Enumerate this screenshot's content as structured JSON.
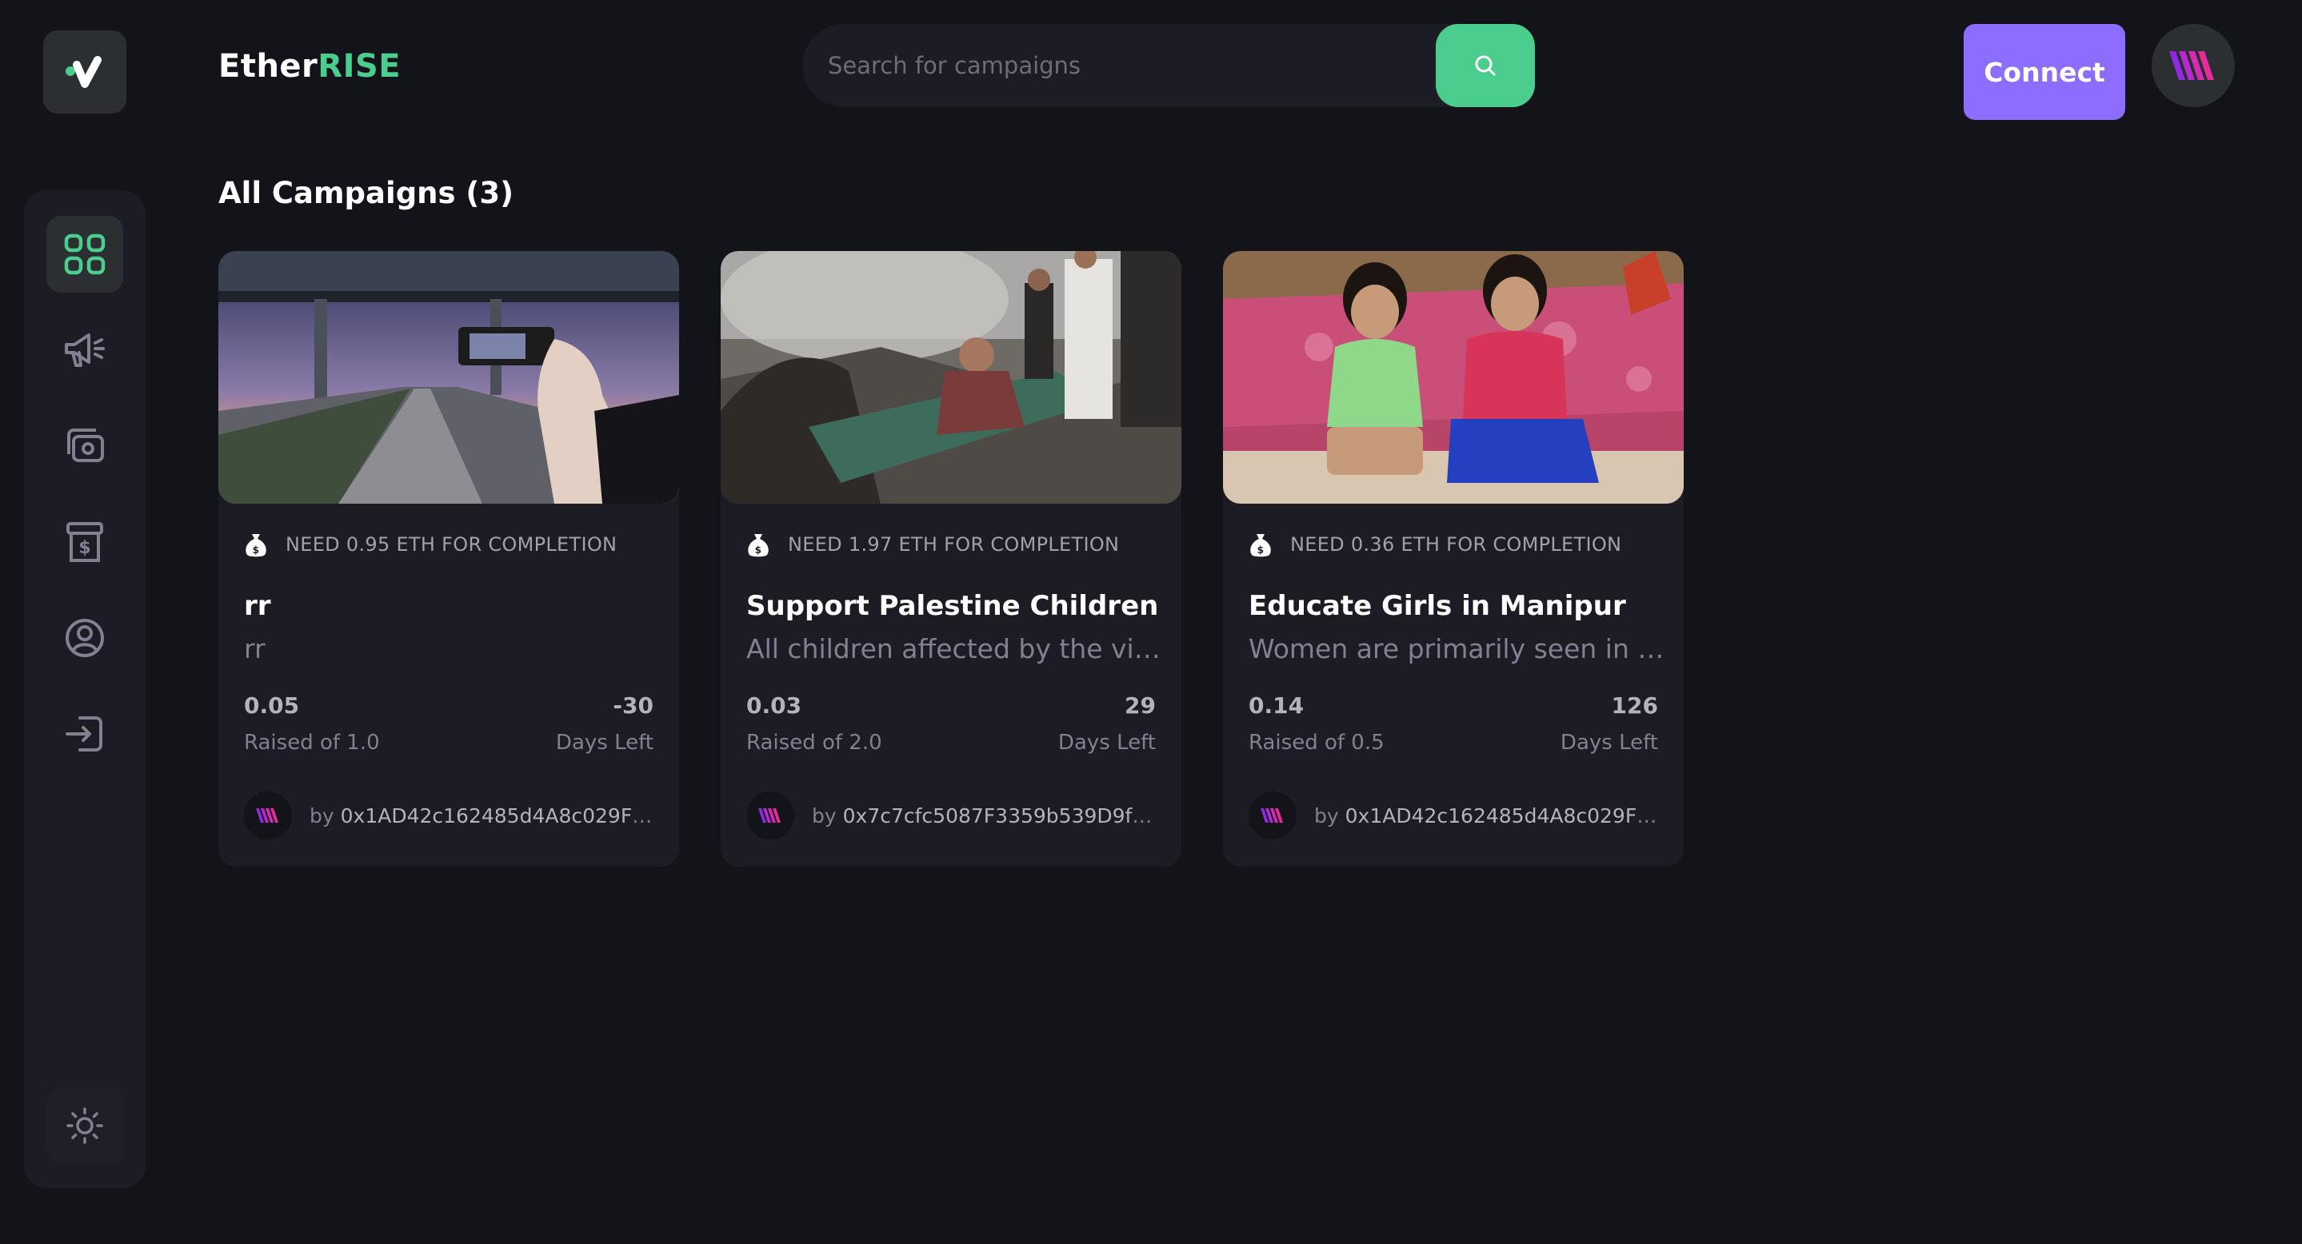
{
  "app": {
    "brand_main": "Ether",
    "brand_accent": "RISE"
  },
  "search": {
    "placeholder": "Search for campaigns"
  },
  "header": {
    "connect_label": "Connect"
  },
  "sidebar": {
    "items": [
      {
        "name": "dashboard",
        "icon": "dashboard-grid-icon",
        "active": true
      },
      {
        "name": "campaign",
        "icon": "megaphone-icon",
        "active": false
      },
      {
        "name": "payment",
        "icon": "payment-icon",
        "active": false
      },
      {
        "name": "withdraw",
        "icon": "withdraw-icon",
        "active": false
      },
      {
        "name": "profile",
        "icon": "profile-icon",
        "active": false
      },
      {
        "name": "logout",
        "icon": "logout-icon",
        "active": false
      }
    ],
    "theme_icon": "sun-icon"
  },
  "main": {
    "title": "All Campaigns (3)"
  },
  "campaigns": [
    {
      "need": "NEED 0.95 ETH FOR COMPLETION",
      "title": "rr",
      "description": "rr",
      "raised": "0.05",
      "raised_label": "Raised of 1.0",
      "days": "-30",
      "days_label": "Days Left",
      "by": "by",
      "owner": "0x1AD42c162485d4A8c029FC734..."
    },
    {
      "need": "NEED 1.97 ETH FOR COMPLETION",
      "title": "Support Palestine Children",
      "description": "All children affected by the viol...",
      "raised": "0.03",
      "raised_label": "Raised of 2.0",
      "days": "29",
      "days_label": "Days Left",
      "by": "by",
      "owner": "0x7c7cfc5087F3359b539D9fb9f0..."
    },
    {
      "need": "NEED 0.36 ETH FOR COMPLETION",
      "title": "Educate Girls in Manipur",
      "description": "Women are primarily seen in th...",
      "raised": "0.14",
      "raised_label": "Raised of 0.5",
      "days": "126",
      "days_label": "Days Left",
      "by": "by",
      "owner": "0x1AD42c162485d4A8c029FC734..."
    }
  ],
  "colors": {
    "accent": "#4acd8d",
    "connect": "#8c6dfd",
    "background": "#13131a",
    "card": "#1c1c24"
  }
}
